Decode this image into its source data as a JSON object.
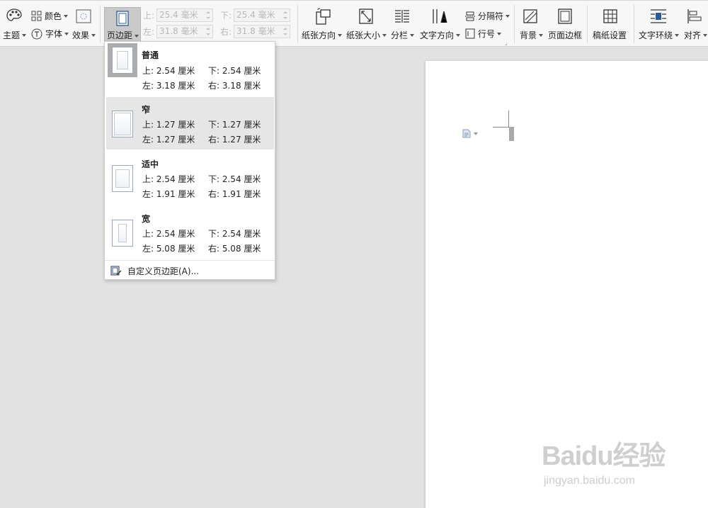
{
  "ribbon": {
    "theme": "主题",
    "colors": "颜色",
    "fonts": "字体",
    "effects": "效果",
    "margins": "页边距",
    "margin_fields": {
      "top_label": "上:",
      "top_value": "25.4 毫米",
      "bottom_label": "下:",
      "bottom_value": "25.4 毫米",
      "left_label": "左:",
      "left_value": "31.8 毫米",
      "right_label": "右:",
      "right_value": "31.8 毫米"
    },
    "orientation": "纸张方向",
    "paper_size": "纸张大小",
    "columns": "分栏",
    "text_direction": "文字方向",
    "breaks": "分隔符",
    "line_numbers": "行号",
    "background": "背景",
    "page_border": "页面边框",
    "manuscript": "稿纸设置",
    "text_wrap": "文字环绕",
    "align": "对齐"
  },
  "margin_menu": {
    "options": [
      {
        "name": "普通",
        "top": "上: 2.54 厘米",
        "bottom": "下: 2.54 厘米",
        "left": "左: 3.18 厘米",
        "right": "右: 3.18 厘米"
      },
      {
        "name": "窄",
        "top": "上: 1.27 厘米",
        "bottom": "下: 1.27 厘米",
        "left": "左: 1.27 厘米",
        "right": "右: 1.27 厘米"
      },
      {
        "name": "适中",
        "top": "上: 2.54 厘米",
        "bottom": "下: 2.54 厘米",
        "left": "左: 1.91 厘米",
        "right": "右: 1.91 厘米"
      },
      {
        "name": "宽",
        "top": "上: 2.54 厘米",
        "bottom": "下: 2.54 厘米",
        "left": "左: 5.08 厘米",
        "right": "右: 5.08 厘米"
      }
    ],
    "custom": "自定义页边距(A)..."
  },
  "watermark": {
    "brand": "Baidu经验",
    "url": "jingyan.baidu.com"
  },
  "colors": {
    "ribbon_bg": "#f7f7f7",
    "workspace_bg": "#e2e2e2",
    "active_button": "#c9c9c9",
    "hover_item": "#e6e6e6",
    "icon_blue": "#2b5a9a"
  }
}
